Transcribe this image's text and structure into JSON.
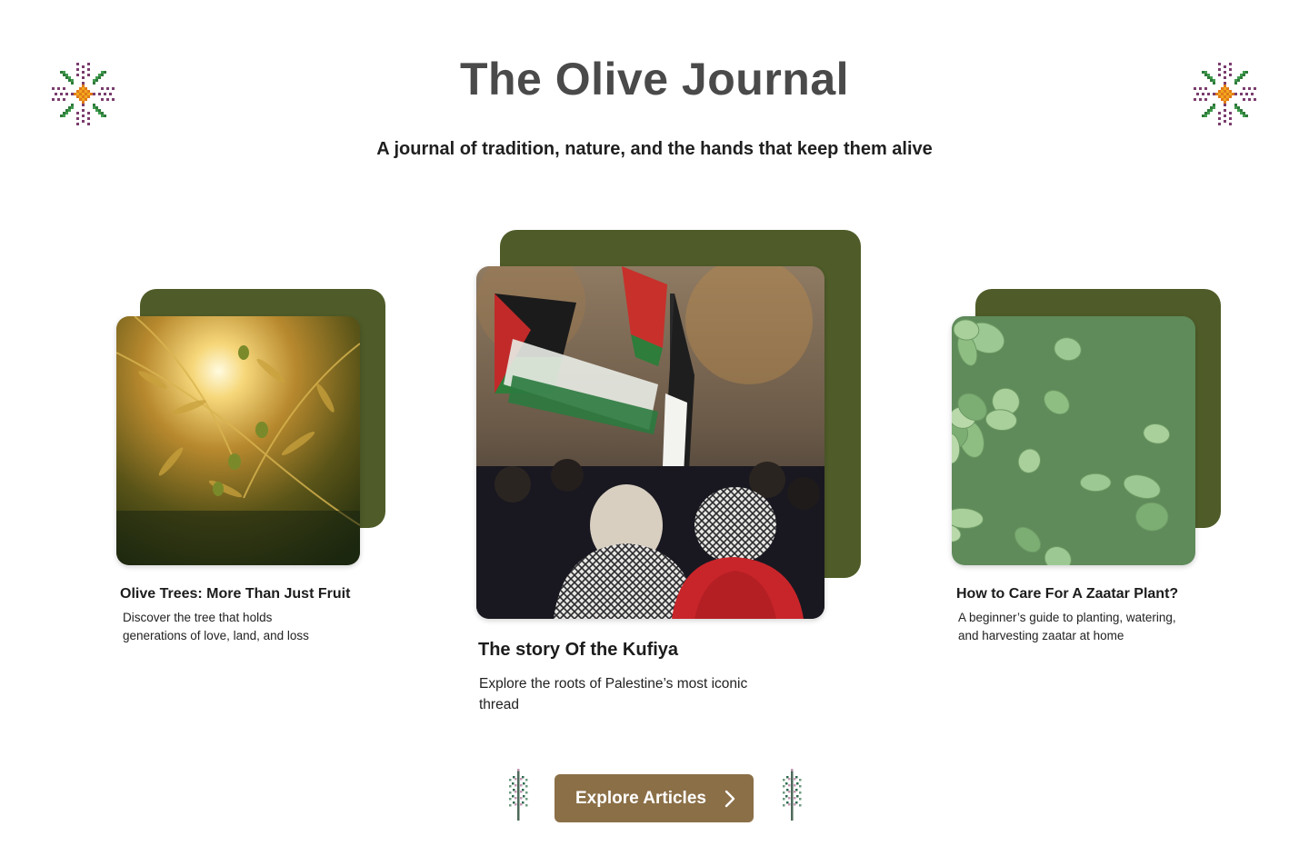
{
  "header": {
    "title": "The Olive Journal",
    "subtitle": "A journal of tradition, nature, and the hands that keep them alive"
  },
  "ornaments": {
    "corner_icon": "tatreez-flower-icon",
    "sprig_icon": "tatreez-sprig-icon"
  },
  "cards": {
    "left": {
      "title": "Olive Trees: More Than Just Fruit",
      "description": "Discover the tree that holds generations of love, land, and loss",
      "image_icon": "olive-branch-sunset-image"
    },
    "center": {
      "title": "The story Of the Kufiya",
      "description": "Explore the roots of Palestine’s most iconic thread",
      "image_icon": "kufiya-protest-image"
    },
    "right": {
      "title": "How to Care For A Zaatar Plant?",
      "description": "A beginner’s guide to planting, watering, and harvesting zaatar at home",
      "image_icon": "zaatar-leaves-image"
    }
  },
  "cta": {
    "label": "Explore Articles",
    "icon": "chevron-right-icon"
  },
  "colors": {
    "olive": "#4f5c29",
    "button": "#8b6f47",
    "title": "#4a4a4a"
  }
}
